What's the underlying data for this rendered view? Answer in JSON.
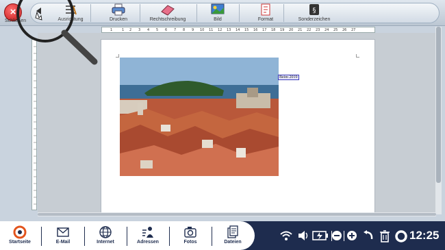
{
  "toolbar": {
    "close_label": "Schließen",
    "items": [
      {
        "label": "Ausrichtung"
      },
      {
        "label": "Drucken"
      },
      {
        "label": "Rechtschreibung"
      },
      {
        "label": "Bild"
      },
      {
        "label": "Format"
      },
      {
        "label": "Sonderzeichen"
      }
    ]
  },
  "ruler": {
    "numbers": [
      "1",
      "1",
      "2",
      "3",
      "4",
      "5",
      "6",
      "7",
      "8",
      "9",
      "10",
      "11",
      "12",
      "13",
      "14",
      "15",
      "16",
      "17",
      "18",
      "19",
      "20",
      "21",
      "22",
      "23",
      "24",
      "25",
      "26",
      "27"
    ]
  },
  "document": {
    "caption": "Beim 2019"
  },
  "taskbar": {
    "items": [
      {
        "label": "Startseite"
      },
      {
        "label": "E-Mail"
      },
      {
        "label": "Internet"
      },
      {
        "label": "Adressen"
      },
      {
        "label": "Fotos"
      },
      {
        "label": "Dateien"
      }
    ],
    "clock": "12:25"
  }
}
